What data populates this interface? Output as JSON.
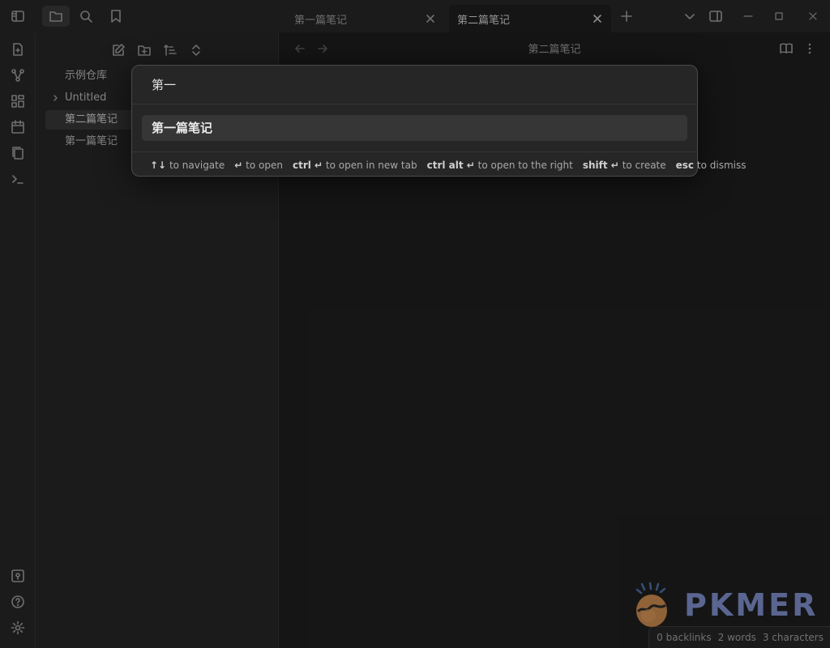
{
  "tabs": [
    {
      "label": "第一篇笔记",
      "active": false
    },
    {
      "label": "第二篇笔记",
      "active": true
    }
  ],
  "sidebar": {
    "items": [
      {
        "label": "示例仓库",
        "type": "vault"
      },
      {
        "label": "Untitled",
        "type": "folder"
      },
      {
        "label": "第二篇笔记",
        "type": "file",
        "selected": true
      },
      {
        "label": "第一篇笔记",
        "type": "file",
        "selected": false
      }
    ]
  },
  "main": {
    "view_title": "第二篇笔记"
  },
  "switcher": {
    "query": "第一",
    "suggestions": [
      {
        "label": "第一篇笔记"
      }
    ],
    "instructions": [
      {
        "key": "↑↓",
        "text": "to navigate"
      },
      {
        "key": "↵",
        "text": "to open"
      },
      {
        "key": "ctrl ↵",
        "text": "to open in new tab"
      },
      {
        "key": "ctrl alt ↵",
        "text": "to open to the right"
      },
      {
        "key": "shift ↵",
        "text": "to create"
      },
      {
        "key": "esc",
        "text": "to dismiss"
      }
    ]
  },
  "status": {
    "backlinks": "0 backlinks",
    "words": "2 words",
    "characters": "3 characters"
  },
  "logo": {
    "text": "PKMER"
  },
  "icons": {
    "ribbon_top": [
      "file-plus-icon",
      "graph-icon",
      "grid-icon",
      "calendar-icon",
      "copy-icon",
      "terminal-icon"
    ],
    "ribbon_bottom": [
      "vault-icon",
      "help-icon",
      "settings-icon"
    ],
    "titlebar": [
      "sidebar-toggle-icon",
      "folder-icon",
      "search-icon",
      "bookmark-icon"
    ]
  },
  "colors": {
    "background": "#1e1e1e",
    "panel": "#262626",
    "accent_logo": "#7d8ec9"
  }
}
